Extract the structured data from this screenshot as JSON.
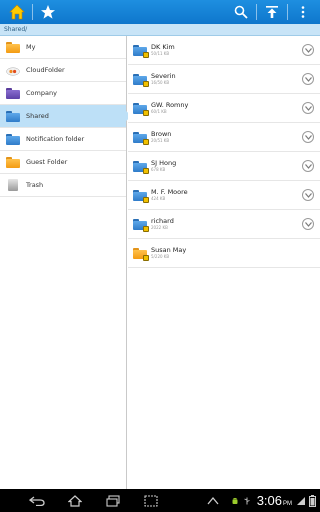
{
  "actionbar": {
    "home_icon": "home-icon",
    "favorites_icon": "star-icon",
    "search_icon": "search-icon",
    "upload_icon": "upload-icon",
    "overflow_icon": "overflow-menu-icon"
  },
  "breadcrumb": {
    "path": "Shared/"
  },
  "left_nav": {
    "items": [
      {
        "label": "My",
        "icon": "folder-orange"
      },
      {
        "label": "CloudFolder",
        "icon": "cloud"
      },
      {
        "label": "Company",
        "icon": "folder-purple"
      },
      {
        "label": "Shared",
        "icon": "folder-blue",
        "selected": true
      },
      {
        "label": "Notification folder",
        "icon": "folder-blue"
      },
      {
        "label": "Guest Folder",
        "icon": "folder-orange"
      },
      {
        "label": "Trash",
        "icon": "trash"
      }
    ]
  },
  "shared_list": {
    "items": [
      {
        "name": "DK Kim",
        "size": "50/11 KB",
        "icon": "folder-blue-lock"
      },
      {
        "name": "Severin",
        "size": "16/50 KB",
        "icon": "folder-blue-lock"
      },
      {
        "name": "GW. Romny",
        "size": "60/1 KB",
        "icon": "folder-blue-lock"
      },
      {
        "name": "Brown",
        "size": "20/51 KB",
        "icon": "folder-blue-lock"
      },
      {
        "name": "SJ Hong",
        "size": "678 KB",
        "icon": "folder-blue-lock"
      },
      {
        "name": "M. F. Moore",
        "size": "424 KB",
        "icon": "folder-blue-lock"
      },
      {
        "name": "richard",
        "size": "2022 KB",
        "icon": "folder-blue-lock"
      },
      {
        "name": "Susan May",
        "size": "5/220 KB",
        "icon": "folder-orange-lock"
      }
    ]
  },
  "status_bar": {
    "time": "3:06",
    "ampm": "PM"
  },
  "colors": {
    "accent": "#0e76cc",
    "selected_bg": "#bde0f7",
    "breadcrumb_bg": "#c8e4f7"
  }
}
